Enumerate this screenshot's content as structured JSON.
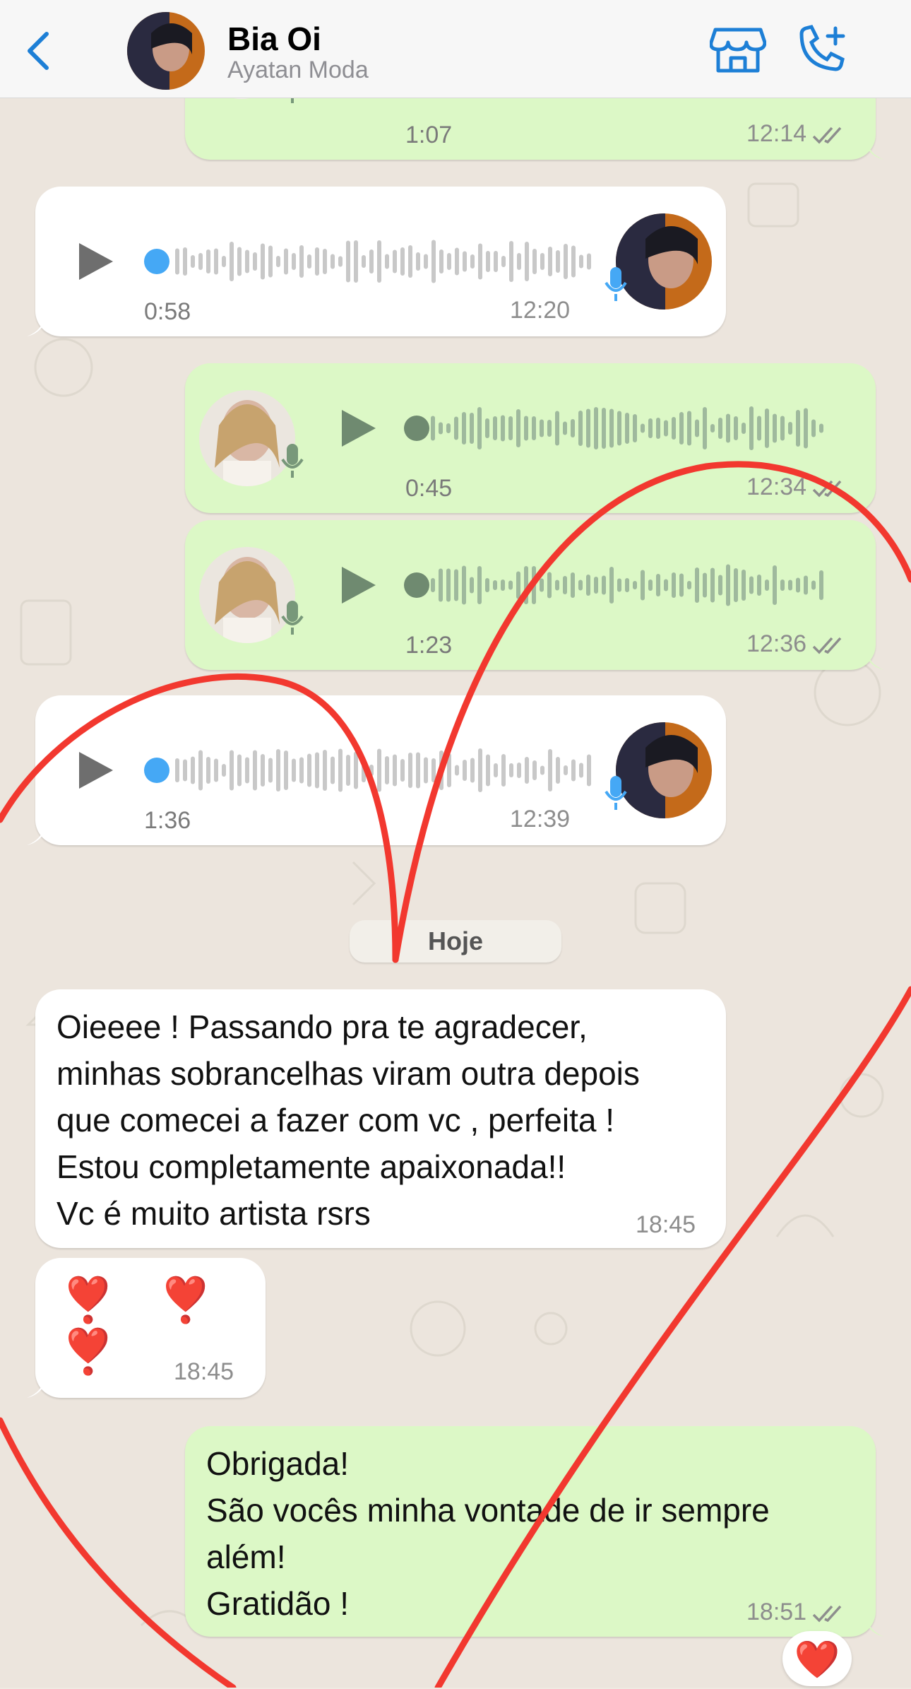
{
  "header": {
    "contact_name": "Bia Oi",
    "contact_subtitle": "Ayatan Moda",
    "icons": [
      "back-chevron-icon",
      "store-icon",
      "add-call-icon"
    ]
  },
  "messages": [
    {
      "id": "m0",
      "type": "voice",
      "direction": "out",
      "duration": "1:07",
      "time": "12:14",
      "read": true,
      "partial": true
    },
    {
      "id": "m1",
      "type": "voice",
      "direction": "in",
      "duration": "0:58",
      "time": "12:20"
    },
    {
      "id": "m2",
      "type": "voice",
      "direction": "out",
      "duration": "0:45",
      "time": "12:34",
      "read": true
    },
    {
      "id": "m3",
      "type": "voice",
      "direction": "out",
      "duration": "1:23",
      "time": "12:36",
      "read": true
    },
    {
      "id": "m4",
      "type": "voice",
      "direction": "in",
      "duration": "1:36",
      "time": "12:39"
    },
    {
      "id": "m5",
      "type": "text",
      "direction": "in",
      "text": "Oieeee ! Passando pra te agradecer,\nminhas sobrancelhas viram outra depois\nque comecei a fazer com vc , perfeita !\nEstou  completamente apaixonada!!\nVc é muito artista rsrs",
      "time": "18:45"
    },
    {
      "id": "m6",
      "type": "text",
      "direction": "in",
      "text": "❣️ ❣️ ❣️",
      "time": "18:45"
    },
    {
      "id": "m7",
      "type": "text",
      "direction": "out",
      "text": "Obrigada!\nSão vocês minha vontade de ir sempre além!\nGratidão !",
      "time": "18:51",
      "read": true,
      "reaction": "❤️"
    }
  ],
  "date_separator": "Hoje",
  "colors": {
    "incoming_bubble": "#ffffff",
    "outgoing_bubble": "#dcf8c6",
    "accent_blue": "#1d7fd6",
    "voice_dot_blue": "#45a8f5",
    "heart_overlay": "#f2382f"
  }
}
